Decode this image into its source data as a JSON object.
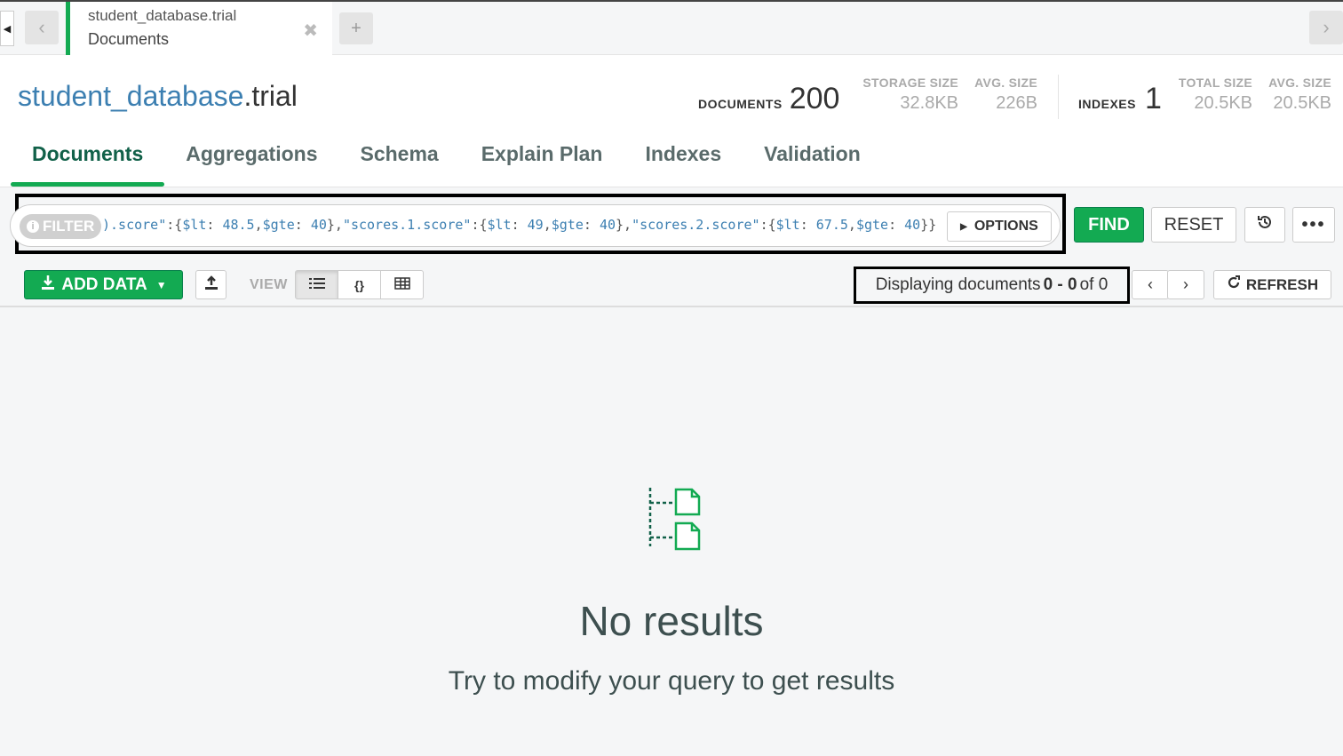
{
  "tabs": {
    "active": {
      "namespace": "student_database.trial",
      "subtitle": "Documents",
      "close_glyph": "✖"
    },
    "add_glyph": "+"
  },
  "header": {
    "db_name": "student_database",
    "collection_suffix": ".trial",
    "documents_label": "DOCUMENTS",
    "documents_count": "200",
    "storage_size_label": "STORAGE SIZE",
    "storage_size_value": "32.8KB",
    "avg_size_label": "AVG. SIZE",
    "avg_size_value": "226B",
    "indexes_label": "INDEXES",
    "indexes_count": "1",
    "total_size_label": "TOTAL SIZE",
    "total_size_value": "20.5KB",
    "index_avg_size_label": "AVG. SIZE",
    "index_avg_size_value": "20.5KB"
  },
  "nav": {
    "items": [
      "Documents",
      "Aggregations",
      "Schema",
      "Explain Plan",
      "Indexes",
      "Validation"
    ],
    "active": "Documents"
  },
  "query": {
    "filter_label": "FILTER",
    "filter_text_parts": [
      {
        "t": ").score\"",
        "c": "k"
      },
      {
        "t": ":{",
        "c": "p"
      },
      {
        "t": "$lt",
        "c": "k"
      },
      {
        "t": ": ",
        "c": "p"
      },
      {
        "t": "48.5",
        "c": "k"
      },
      {
        "t": ",",
        "c": "p"
      },
      {
        "t": "$gte",
        "c": "k"
      },
      {
        "t": ": ",
        "c": "p"
      },
      {
        "t": "40",
        "c": "k"
      },
      {
        "t": "},",
        "c": "p"
      },
      {
        "t": "\"scores.1.score\"",
        "c": "k"
      },
      {
        "t": ":{",
        "c": "p"
      },
      {
        "t": "$lt",
        "c": "k"
      },
      {
        "t": ": ",
        "c": "p"
      },
      {
        "t": "49",
        "c": "k"
      },
      {
        "t": ",",
        "c": "p"
      },
      {
        "t": "$gte",
        "c": "k"
      },
      {
        "t": ": ",
        "c": "p"
      },
      {
        "t": "40",
        "c": "k"
      },
      {
        "t": "},",
        "c": "p"
      },
      {
        "t": "\"scores.2.score\"",
        "c": "k"
      },
      {
        "t": ":{",
        "c": "p"
      },
      {
        "t": "$lt",
        "c": "k"
      },
      {
        "t": ": ",
        "c": "p"
      },
      {
        "t": "67.5",
        "c": "k"
      },
      {
        "t": ",",
        "c": "p"
      },
      {
        "t": "$gte",
        "c": "k"
      },
      {
        "t": ": ",
        "c": "p"
      },
      {
        "t": "40",
        "c": "k"
      },
      {
        "t": "}}",
        "c": "p"
      }
    ],
    "options_label": "OPTIONS",
    "find_label": "FIND",
    "reset_label": "RESET"
  },
  "toolbar": {
    "add_data_label": "ADD DATA",
    "view_label": "VIEW",
    "display_prefix": "Displaying documents",
    "display_range": "0 - 0",
    "display_of": "of",
    "display_total": "0",
    "refresh_label": "REFRESH"
  },
  "empty": {
    "title": "No results",
    "subtitle": "Try to modify your query to get results"
  },
  "colors": {
    "brand_green": "#13aa52",
    "db_blue": "#3c7fb1",
    "active_tab_text": "#116149"
  }
}
